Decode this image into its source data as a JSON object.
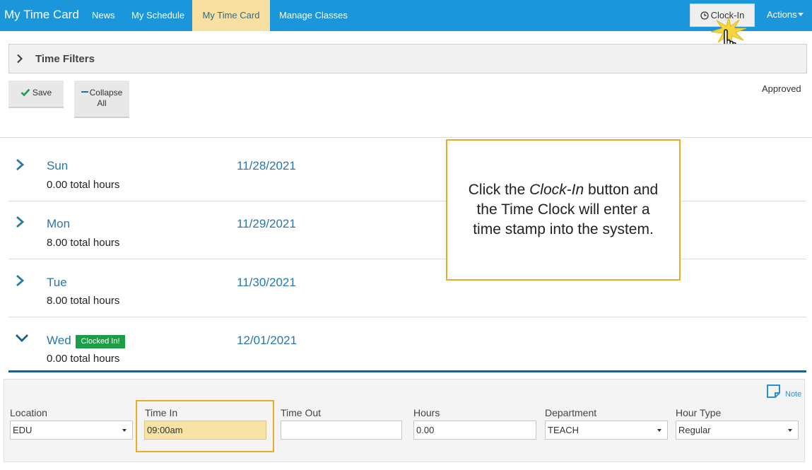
{
  "nav": {
    "brand": "My Time Card",
    "links": [
      "News",
      "My Schedule",
      "My Time Card",
      "Manage Classes"
    ],
    "clock_in_label": "Clock-In",
    "actions_label": "Actions"
  },
  "filters": {
    "label": "Time Filters"
  },
  "toolbar": {
    "save_label": "Save",
    "collapse_line1": "Collapse",
    "collapse_line2": "All",
    "status": "Approved"
  },
  "days": [
    {
      "name": "Sun",
      "date": "11/28/2021",
      "hours": "0.00 total hours",
      "expanded": false
    },
    {
      "name": "Mon",
      "date": "11/29/2021",
      "hours": "8.00 total hours",
      "expanded": false
    },
    {
      "name": "Tue",
      "date": "11/30/2021",
      "hours": "8.00 total hours",
      "expanded": false
    },
    {
      "name": "Wed",
      "date": "12/01/2021",
      "hours": "0.00 total hours",
      "expanded": true,
      "badge": "Clocked In!"
    }
  ],
  "callout": {
    "prefix": "Click the ",
    "emphasis": "Clock-In",
    "suffix": " button and the Time Clock will enter a time stamp into the system."
  },
  "entry": {
    "note_label": "Note",
    "location": {
      "label": "Location",
      "value": "EDU"
    },
    "time_in": {
      "label": "Time In",
      "value": "09:00am"
    },
    "time_out": {
      "label": "Time Out",
      "value": ""
    },
    "hours": {
      "label": "Hours",
      "value": "0.00"
    },
    "department": {
      "label": "Department",
      "value": "TEACH"
    },
    "hour_type": {
      "label": "Hour Type",
      "value": "Regular"
    }
  },
  "colors": {
    "nav_bg": "#1b96db",
    "active_tab": "#f8e0a2",
    "highlight": "#e7ac24",
    "badge_green": "#1e9c47",
    "link_blue": "#2778a8"
  },
  "icons": [
    "clock-icon",
    "pointer-hand-icon",
    "chevron-right-icon",
    "chevron-down-icon",
    "checkmark-icon",
    "note-icon",
    "caret-down-icon"
  ]
}
